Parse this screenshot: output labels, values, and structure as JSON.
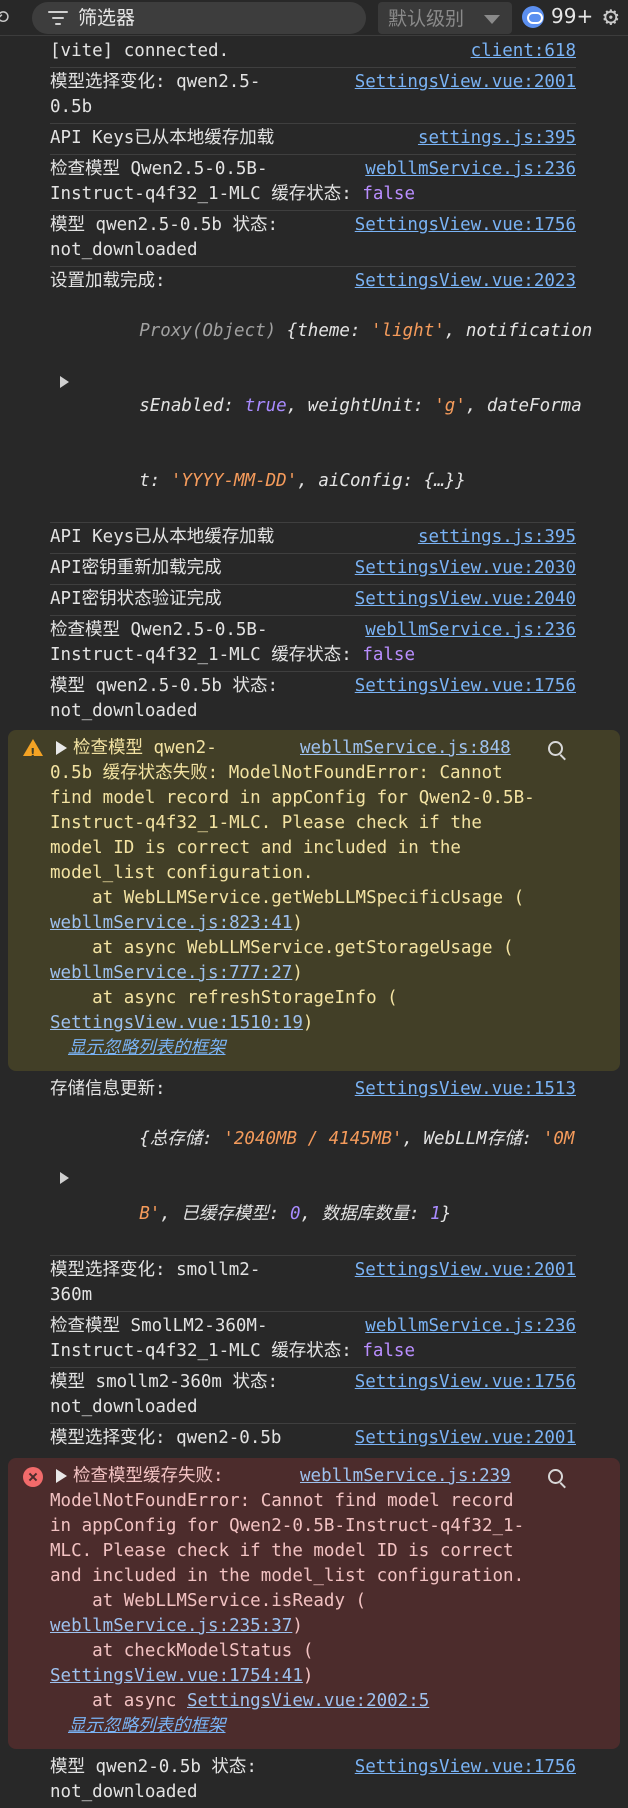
{
  "toolbar": {
    "filter_placeholder": "筛选器",
    "level_label": "默认级别",
    "message_count": "99+"
  },
  "rows": {
    "r1": {
      "text": "[vite] connected.",
      "src": "client:618"
    },
    "r2": {
      "l1": "模型选择变化: qwen2.5-",
      "l2": "0.5b",
      "src": "SettingsView.vue:2001"
    },
    "r3": {
      "text": "API Keys已从本地缓存加载",
      "src": "settings.js:395"
    },
    "r4": {
      "l1": "检查模型 Qwen2.5-0.5B-",
      "l2": "Instruct-q4f32_1-MLC 缓存状态: ",
      "flag": "false",
      "src": "webllmService.js:236"
    },
    "r5": {
      "l1": "模型 qwen2.5-0.5b 状态:",
      "l2": "not_downloaded",
      "src": "SettingsView.vue:1756"
    },
    "r6": {
      "l1": "设置加载完成:",
      "src": "SettingsView.vue:2023",
      "o1_proxy": "Proxy(Object) ",
      "o1_rest": "{theme: ",
      "o1_theme": "'light'",
      "o1_tail": ", notification",
      "o2_a": "sEnabled: ",
      "o2_true": "true",
      "o2_b": ", weightUnit: ",
      "o2_g": "'g'",
      "o2_c": ", dateForma",
      "o3_a": "t: ",
      "o3_fmt": "'YYYY-MM-DD'",
      "o3_b": ", aiConfig: {…}}"
    },
    "r7": {
      "text": "API Keys已从本地缓存加载",
      "src": "settings.js:395"
    },
    "r8": {
      "text": "API密钥重新加载完成",
      "src": "SettingsView.vue:2030"
    },
    "r9": {
      "text": "API密钥状态验证完成",
      "src": "SettingsView.vue:2040"
    },
    "r10": {
      "l1": "检查模型 Qwen2.5-0.5B-",
      "l2": "Instruct-q4f32_1-MLC 缓存状态: ",
      "flag": "false",
      "src": "webllmService.js:236"
    },
    "r11": {
      "l1": "模型 qwen2.5-0.5b 状态:",
      "l2": "not_downloaded",
      "src": "SettingsView.vue:1756"
    }
  },
  "warning": {
    "head": "检查模型 qwen2-",
    "src": "webllmService.js:848",
    "lines": [
      "0.5b 缓存状态失败: ModelNotFoundError: Cannot",
      "find model record in appConfig for Qwen2-0.5B-",
      "Instruct-q4f32_1-MLC. Please check if the",
      "model ID is correct and included in the",
      "model_list configuration."
    ],
    "at1": "    at WebLLMService.getWebLLMSpecificUsage (",
    "at1_link": "webllmService.js:823:41",
    "at2": "    at async WebLLMService.getStorageUsage (",
    "at2_link": "webllmService.js:777:27",
    "at3": "    at async refreshStorageInfo (",
    "at3_link": "SettingsView.vue:1510:19",
    "close": ")",
    "ignore": "显示忽略列表的框架"
  },
  "storage": {
    "l1": "存储信息更新:",
    "src": "SettingsView.vue:1513",
    "o1_a": "{总存储: ",
    "o1_v": "'2040MB / 4145MB'",
    "o1_b": ", WebLLM存储: ",
    "o1_c": "'0M",
    "o2_a": "B'",
    "o2_b": ", 已缓存模型: ",
    "o2_n": "0",
    "o2_c": ", 数据库数量: ",
    "o2_d": "1",
    "o2_e": "}"
  },
  "rows2": {
    "r12": {
      "l1": "模型选择变化: smollm2-",
      "l2": "360m",
      "src": "SettingsView.vue:2001"
    },
    "r13": {
      "l1": "检查模型 SmolLM2-360M-",
      "l2": "Instruct-q4f32_1-MLC 缓存状态: ",
      "flag": "false",
      "src": "webllmService.js:236"
    },
    "r14": {
      "l1": "模型 smollm2-360m 状态:",
      "l2": "not_downloaded",
      "src": "SettingsView.vue:1756"
    },
    "r15": {
      "text": "模型选择变化: qwen2-0.5b",
      "src": "SettingsView.vue:2001"
    }
  },
  "error": {
    "head": "检查模型缓存失败:",
    "src": "webllmService.js:239",
    "lines": [
      "ModelNotFoundError: Cannot find model record",
      "in appConfig for Qwen2-0.5B-Instruct-q4f32_1-",
      "MLC. Please check if the model ID is correct",
      "and included in the model_list configuration."
    ],
    "at1": "    at WebLLMService.isReady (",
    "at1_link": "webllmService.js:235:37",
    "at2": "    at checkModelStatus (",
    "at2_link": "SettingsView.vue:1754:41",
    "at3": "    at async ",
    "at3_link": "SettingsView.vue:2002:5",
    "close": ")",
    "ignore": "显示忽略列表的框架"
  },
  "rows3": {
    "r16": {
      "l1": "模型 qwen2-0.5b 状态:",
      "l2": "not_downloaded",
      "src": "SettingsView.vue:1756"
    }
  }
}
